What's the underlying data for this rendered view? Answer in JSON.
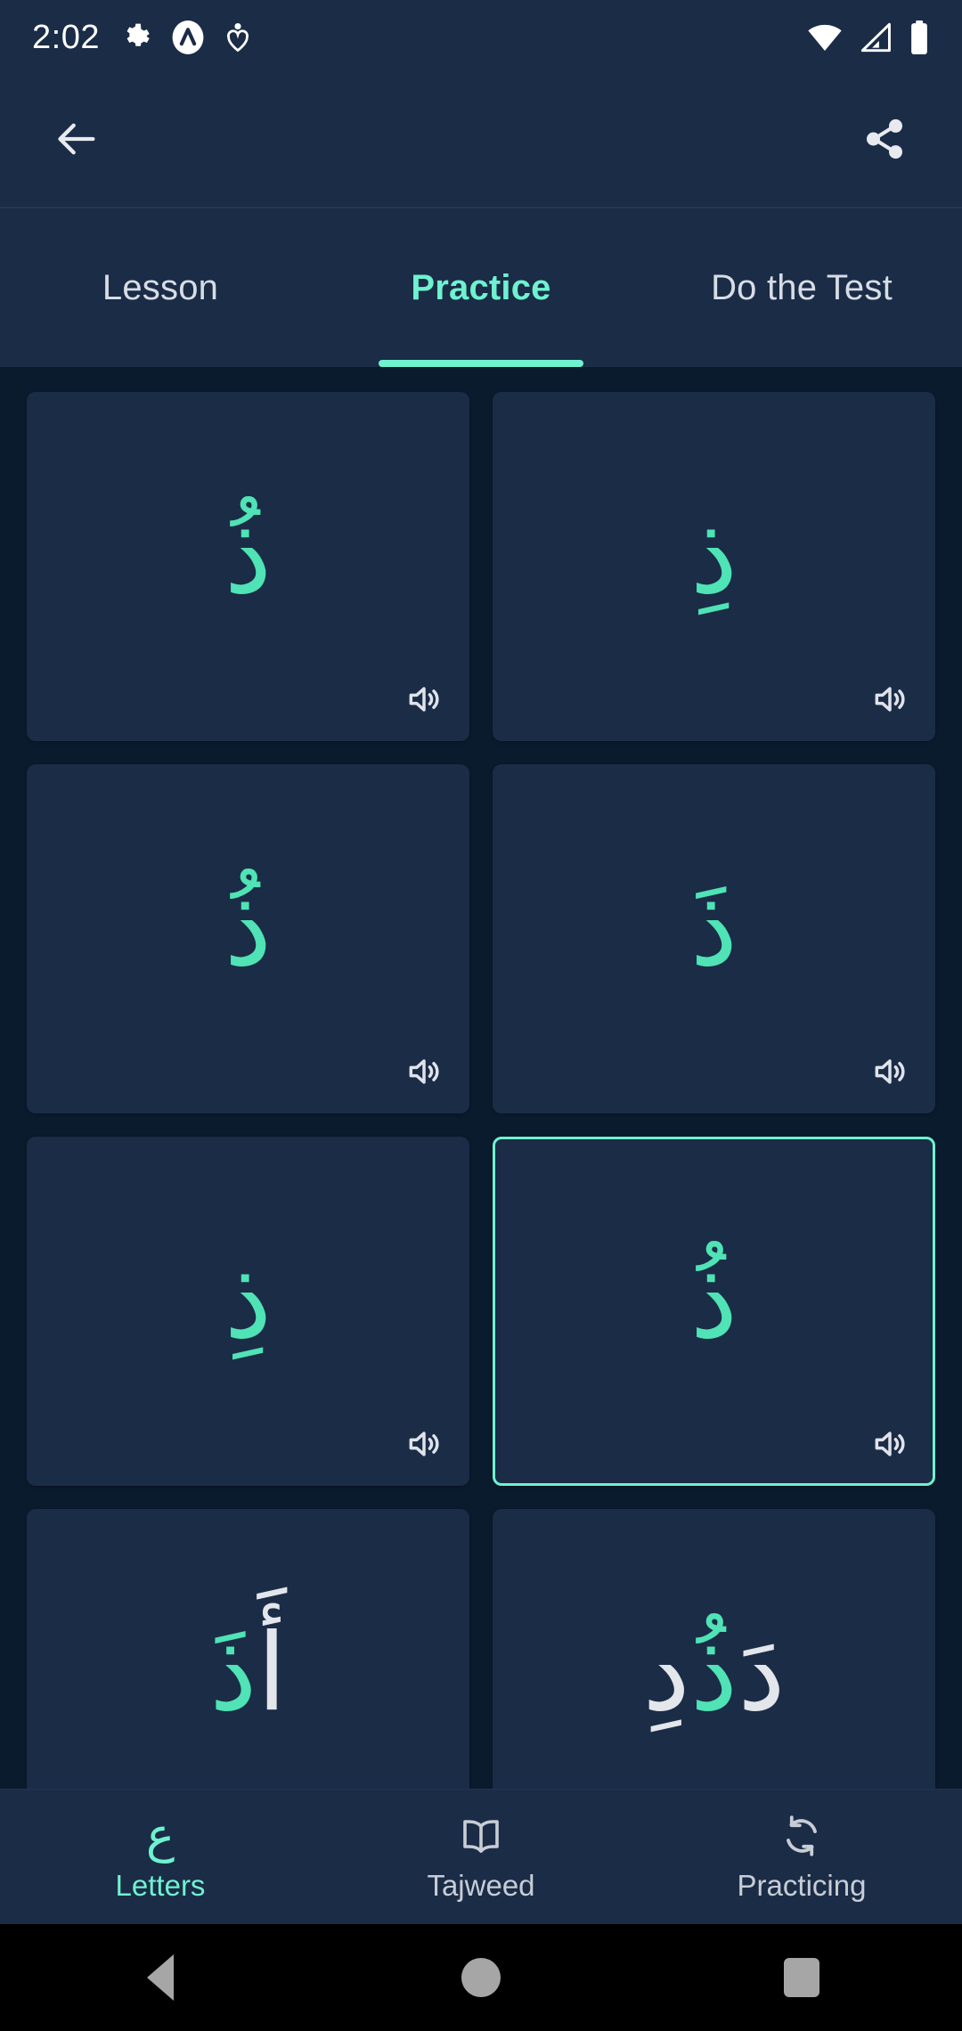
{
  "status_bar": {
    "time": "2:02",
    "left_icons": [
      "gear-icon",
      "app-badge-icon",
      "heart-person-icon"
    ],
    "right_icons": [
      "wifi-icon",
      "cellular-no-signal-icon",
      "battery-full-icon"
    ]
  },
  "app_bar": {
    "back_icon": "back-arrow-icon",
    "share_icon": "share-icon"
  },
  "tabs": {
    "items": [
      {
        "label": "Lesson",
        "active": false
      },
      {
        "label": "Practice",
        "active": true
      },
      {
        "label": "Do the Test",
        "active": false
      }
    ]
  },
  "practice_grid": {
    "speaker_icon": "speaker-icon",
    "cards": [
      {
        "text": "ذُ",
        "selected": false,
        "context_before": "",
        "context_after": ""
      },
      {
        "text": "ذِ",
        "selected": false,
        "context_before": "",
        "context_after": ""
      },
      {
        "text": "ذُ",
        "selected": false,
        "context_before": "",
        "context_after": ""
      },
      {
        "text": "ذَ",
        "selected": false,
        "context_before": "",
        "context_after": ""
      },
      {
        "text": "ذِ",
        "selected": false,
        "context_before": "",
        "context_after": ""
      },
      {
        "text": "ذُ",
        "selected": true,
        "context_before": "",
        "context_after": ""
      },
      {
        "text": "ذَ",
        "selected": false,
        "context_before": "أَ",
        "context_after": ""
      },
      {
        "text": "ذُ",
        "selected": false,
        "context_before": "دَ",
        "context_after": "دِ"
      }
    ]
  },
  "bottom_nav": {
    "items": [
      {
        "label": "Letters",
        "icon": "arabic-ain-icon",
        "glyph": "ع",
        "active": true
      },
      {
        "label": "Tajweed",
        "icon": "open-book-icon",
        "glyph": "",
        "active": false
      },
      {
        "label": "Practicing",
        "icon": "sync-refresh-icon",
        "glyph": "",
        "active": false
      }
    ]
  },
  "android_nav": {
    "back": "android-back-icon",
    "home": "android-home-icon",
    "recents": "android-recents-icon"
  },
  "colors": {
    "accent": "#6ef2cf",
    "glyph": "#4fe3b5",
    "surface": "#1b2c47",
    "background": "#0b1b2e"
  }
}
